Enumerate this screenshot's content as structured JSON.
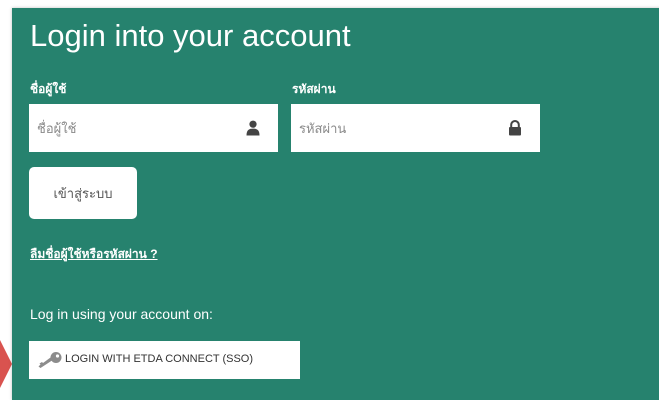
{
  "header": {
    "title": "Login into your account"
  },
  "form": {
    "username_label": "ชื่อผู้ใช้",
    "username_placeholder": "ชื่อผู้ใช้",
    "username_value": "",
    "password_label": "รหัสผ่าน",
    "password_placeholder": "รหัสผ่าน",
    "password_value": "",
    "submit_label": "เข้าสู่ระบบ",
    "forgot_link": "ลืมชื่อผู้ใช้หรือรหัสผ่าน ?"
  },
  "sso": {
    "caption": "Log in using your account on:",
    "button_label": "LOGIN WITH ETDA CONNECT (SSO)"
  },
  "icons": {
    "username": "user-icon",
    "password": "lock-icon",
    "sso": "key-icon",
    "pointer": "red-arrow-indicator"
  },
  "colors": {
    "panel_background": "#26826e",
    "field_background": "#ffffff",
    "text_on_panel": "#ffffff",
    "indicator_arrow": "#d9534f"
  }
}
